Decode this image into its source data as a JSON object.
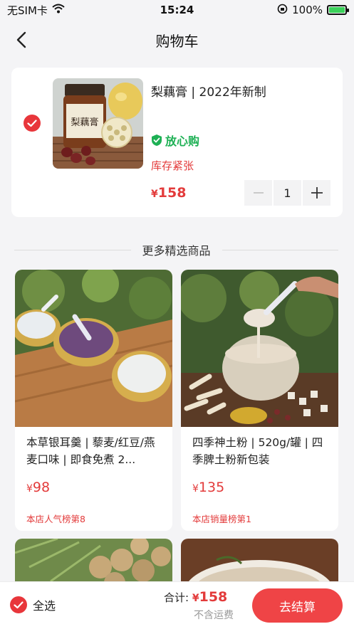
{
  "status_bar": {
    "carrier": "无SIM卡",
    "time": "15:24",
    "battery": "100%"
  },
  "nav": {
    "title": "购物车"
  },
  "cart_item": {
    "name": "梨藕膏 | 2022年新制",
    "assurance": "放心购",
    "stock_note": "库存紧张",
    "currency": "¥",
    "price": "158",
    "quantity": "1",
    "jar_label": "梨藕膏"
  },
  "more_section": {
    "title": "更多精选商品"
  },
  "products": [
    {
      "title": "本草银耳羹 | 藜麦/红豆/燕麦口味 | 即食免煮 2...",
      "currency": "¥",
      "price": "98",
      "rank": "本店人气榜第8"
    },
    {
      "title": "四季神土粉 | 520g/罐 | 四季脾土粉新包装",
      "currency": "¥",
      "price": "135",
      "rank": "本店销量榜第1"
    }
  ],
  "bottom_bar": {
    "select_all": "全选",
    "total_label": "合计:",
    "currency": "¥",
    "total": "158",
    "shipping_note": "不含运费",
    "checkout_label": "去结算"
  },
  "colors": {
    "accent": "#e8363b",
    "assurance_green": "#1db054",
    "background": "#f4f4f6"
  }
}
